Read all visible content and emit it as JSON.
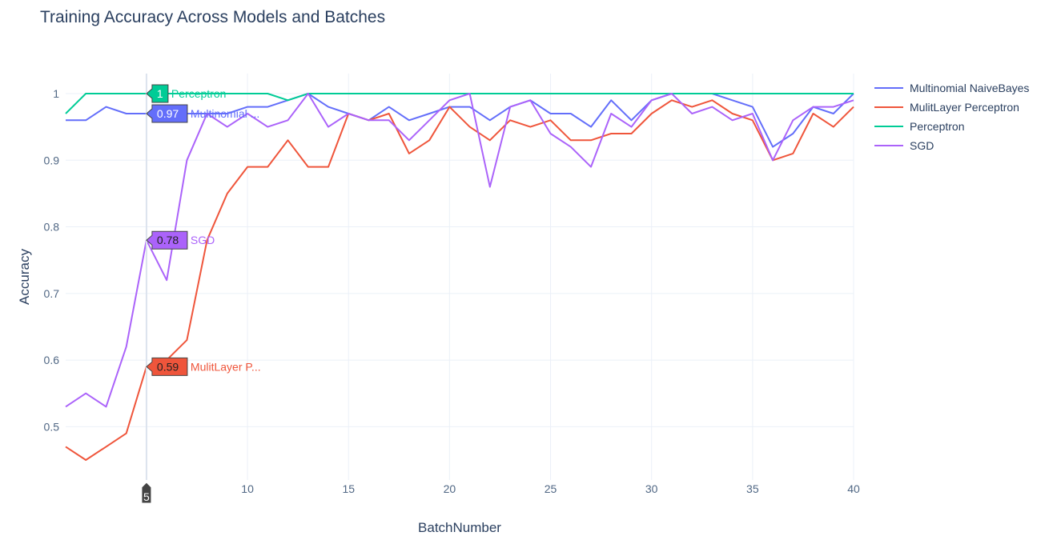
{
  "chart_data": {
    "type": "line",
    "title": "Training Accuracy Across Models and Batches",
    "xlabel": "BatchNumber",
    "ylabel": "Accuracy",
    "xlim": [
      1,
      40
    ],
    "ylim": [
      0.42,
      1.03
    ],
    "x": [
      1,
      2,
      3,
      4,
      5,
      6,
      7,
      8,
      9,
      10,
      11,
      12,
      13,
      14,
      15,
      16,
      17,
      18,
      19,
      20,
      21,
      22,
      23,
      24,
      25,
      26,
      27,
      28,
      29,
      30,
      31,
      32,
      33,
      34,
      35,
      36,
      37,
      38,
      39,
      40
    ],
    "x_ticks": [
      5,
      10,
      15,
      20,
      25,
      30,
      35,
      40
    ],
    "y_ticks": [
      0.5,
      0.6,
      0.7,
      0.8,
      0.9,
      1
    ],
    "grid": true,
    "legend_position": "top-right",
    "series": [
      {
        "name": "Multinomial NaiveBayes",
        "color": "#636efa",
        "values": [
          0.96,
          0.96,
          0.98,
          0.97,
          0.97,
          0.97,
          0.97,
          0.97,
          0.97,
          0.98,
          0.98,
          0.99,
          1.0,
          0.98,
          0.97,
          0.96,
          0.98,
          0.96,
          0.97,
          0.98,
          0.98,
          0.96,
          0.98,
          0.99,
          0.97,
          0.97,
          0.95,
          0.99,
          0.96,
          0.99,
          1.0,
          1.0,
          1.0,
          0.99,
          0.98,
          0.92,
          0.94,
          0.98,
          0.97,
          1.0
        ]
      },
      {
        "name": "MulitLayer Perceptron",
        "color": "#ef553b",
        "values": [
          0.47,
          0.45,
          0.47,
          0.49,
          0.59,
          0.6,
          0.63,
          0.78,
          0.85,
          0.89,
          0.89,
          0.93,
          0.89,
          0.89,
          0.97,
          0.96,
          0.97,
          0.91,
          0.93,
          0.98,
          0.95,
          0.93,
          0.96,
          0.95,
          0.96,
          0.93,
          0.93,
          0.94,
          0.94,
          0.97,
          0.99,
          0.98,
          0.99,
          0.97,
          0.96,
          0.9,
          0.91,
          0.97,
          0.95,
          0.98
        ]
      },
      {
        "name": "Perceptron",
        "color": "#00cc96",
        "values": [
          0.97,
          1.0,
          1.0,
          1.0,
          1.0,
          1.0,
          1.0,
          1.0,
          1.0,
          1.0,
          1.0,
          0.99,
          1.0,
          1.0,
          1.0,
          1.0,
          1.0,
          1.0,
          1.0,
          1.0,
          1.0,
          1.0,
          1.0,
          1.0,
          1.0,
          1.0,
          1.0,
          1.0,
          1.0,
          1.0,
          1.0,
          1.0,
          1.0,
          1.0,
          1.0,
          1.0,
          1.0,
          1.0,
          1.0,
          1.0
        ]
      },
      {
        "name": "SGD",
        "color": "#ab63fa",
        "values": [
          0.53,
          0.55,
          0.53,
          0.62,
          0.78,
          0.72,
          0.9,
          0.97,
          0.95,
          0.97,
          0.95,
          0.96,
          1.0,
          0.95,
          0.97,
          0.96,
          0.96,
          0.93,
          0.96,
          0.99,
          1.0,
          0.86,
          0.98,
          0.99,
          0.94,
          0.92,
          0.89,
          0.97,
          0.95,
          0.99,
          1.0,
          0.97,
          0.98,
          0.96,
          0.97,
          0.9,
          0.96,
          0.98,
          0.98,
          0.99
        ]
      }
    ],
    "hover": {
      "x_label": "5",
      "labels": [
        {
          "series": "Perceptron",
          "value": "1",
          "text": "Perceptron",
          "color": "#00cc96",
          "label_y": 1.0
        },
        {
          "series": "Multinomial NaiveBayes",
          "value": "0.97",
          "text": "Multinomial ...",
          "color": "#636efa",
          "label_y": 0.97
        },
        {
          "series": "SGD",
          "value": "0.78",
          "text": "SGD",
          "color": "#ab63fa",
          "label_y": 0.78
        },
        {
          "series": "MulitLayer Perceptron",
          "value": "0.59",
          "text": "MulitLayer P...",
          "color": "#ef553b",
          "label_y": 0.59
        }
      ]
    }
  }
}
